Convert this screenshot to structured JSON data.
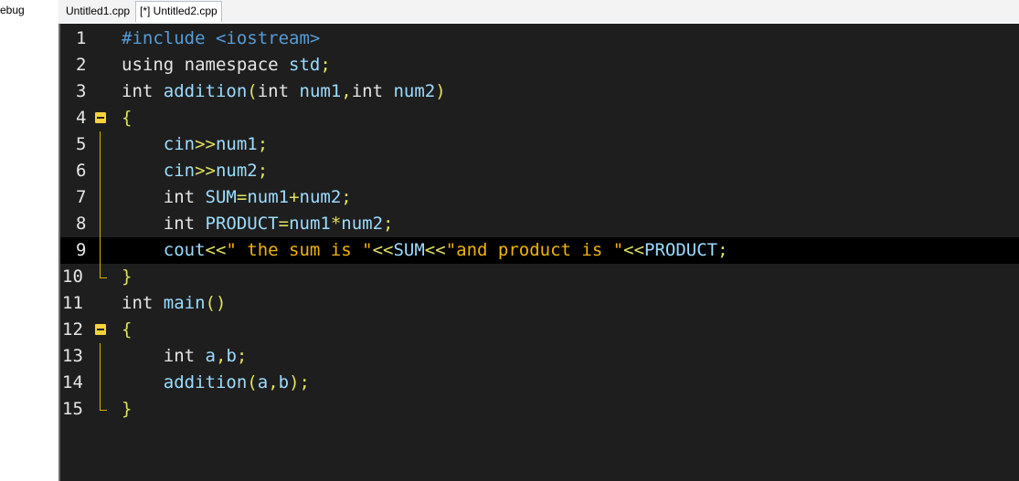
{
  "left_panel": {
    "label": "ebug"
  },
  "tabs": [
    {
      "label": "Untitled1.cpp",
      "active": false
    },
    {
      "label": "[*] Untitled2.cpp",
      "active": true
    }
  ],
  "editor": {
    "highlight_line": 9,
    "lines": [
      {
        "num": "1",
        "parts": [
          [
            "#include <iostream>",
            "pp"
          ]
        ]
      },
      {
        "num": "2",
        "parts": [
          [
            "using namespace ",
            "plain"
          ],
          [
            "std",
            "id"
          ],
          [
            ";",
            "sym"
          ]
        ]
      },
      {
        "num": "3",
        "parts": [
          [
            "int ",
            "plain"
          ],
          [
            "addition",
            "id"
          ],
          [
            "(",
            "sym"
          ],
          [
            "int ",
            "plain"
          ],
          [
            "num1",
            "id"
          ],
          [
            ",",
            "sym"
          ],
          [
            "int ",
            "plain"
          ],
          [
            "num2",
            "id"
          ],
          [
            ")",
            "sym"
          ]
        ]
      },
      {
        "num": "4",
        "parts": [
          [
            "{",
            "sym"
          ]
        ]
      },
      {
        "num": "5",
        "parts": [
          [
            "    ",
            "plain"
          ],
          [
            "cin",
            "id"
          ],
          [
            ">>",
            "op"
          ],
          [
            "num1",
            "id"
          ],
          [
            ";",
            "sym"
          ]
        ]
      },
      {
        "num": "6",
        "parts": [
          [
            "    ",
            "plain"
          ],
          [
            "cin",
            "id"
          ],
          [
            ">>",
            "op"
          ],
          [
            "num2",
            "id"
          ],
          [
            ";",
            "sym"
          ]
        ]
      },
      {
        "num": "7",
        "parts": [
          [
            "    ",
            "plain"
          ],
          [
            "int ",
            "plain"
          ],
          [
            "SUM",
            "id"
          ],
          [
            "=",
            "op"
          ],
          [
            "num1",
            "id"
          ],
          [
            "+",
            "op"
          ],
          [
            "num2",
            "id"
          ],
          [
            ";",
            "sym"
          ]
        ]
      },
      {
        "num": "8",
        "parts": [
          [
            "    ",
            "plain"
          ],
          [
            "int ",
            "plain"
          ],
          [
            "PRODUCT",
            "id"
          ],
          [
            "=",
            "op"
          ],
          [
            "num1",
            "id"
          ],
          [
            "*",
            "op"
          ],
          [
            "num2",
            "id"
          ],
          [
            ";",
            "sym"
          ]
        ]
      },
      {
        "num": "9",
        "parts": [
          [
            "    ",
            "plain"
          ],
          [
            "cout",
            "id"
          ],
          [
            "<<",
            "op"
          ],
          [
            "\" the sum is \"",
            "str"
          ],
          [
            "<<",
            "op"
          ],
          [
            "SUM",
            "id"
          ],
          [
            "<<",
            "op"
          ],
          [
            "\"and product is \"",
            "str"
          ],
          [
            "<<",
            "op"
          ],
          [
            "PRODUCT",
            "id"
          ],
          [
            ";",
            "sym"
          ]
        ]
      },
      {
        "num": "10",
        "parts": [
          [
            "}",
            "sym"
          ]
        ]
      },
      {
        "num": "11",
        "parts": [
          [
            "int ",
            "plain"
          ],
          [
            "main",
            "id"
          ],
          [
            "()",
            "sym"
          ]
        ]
      },
      {
        "num": "12",
        "parts": [
          [
            "{",
            "sym"
          ]
        ]
      },
      {
        "num": "13",
        "parts": [
          [
            "    ",
            "plain"
          ],
          [
            "int ",
            "plain"
          ],
          [
            "a",
            "id"
          ],
          [
            ",",
            "sym"
          ],
          [
            "b",
            "id"
          ],
          [
            ";",
            "sym"
          ]
        ]
      },
      {
        "num": "14",
        "parts": [
          [
            "    ",
            "plain"
          ],
          [
            "addition",
            "id"
          ],
          [
            "(",
            "sym"
          ],
          [
            "a",
            "id"
          ],
          [
            ",",
            "sym"
          ],
          [
            "b",
            "id"
          ],
          [
            ");",
            "sym"
          ]
        ]
      },
      {
        "num": "15",
        "parts": [
          [
            "}",
            "sym"
          ]
        ]
      }
    ],
    "fold_markers": [
      4,
      12
    ],
    "fold_ends": [
      10,
      15
    ]
  },
  "colors": {
    "editor_bg": "#1e1e1e",
    "highlight_bg": "#000000",
    "fold_marker": "#f7d23a",
    "string": "#f0b400",
    "identifier": "#9cdcfe",
    "preprocessor": "#569cd6"
  }
}
